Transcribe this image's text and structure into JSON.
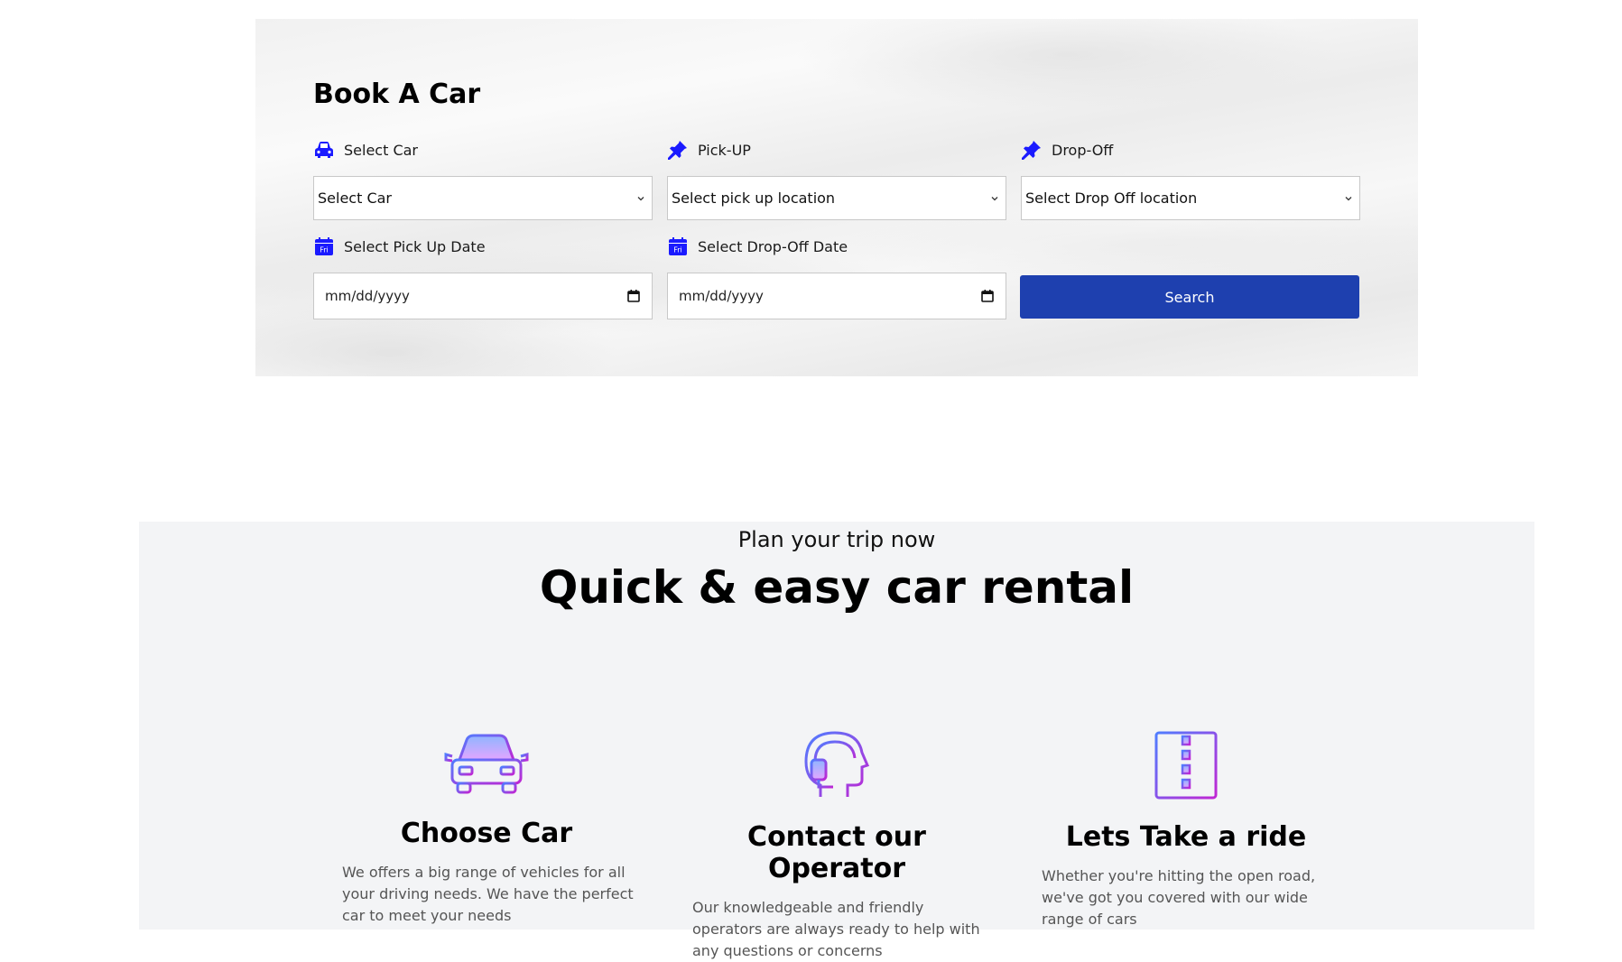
{
  "booking": {
    "title": "Book A Car",
    "select_car": {
      "label": "Select Car",
      "value": "Select Car"
    },
    "pick_up": {
      "label": "Pick-UP",
      "value": "Select pick up location"
    },
    "drop_off": {
      "label": "Drop-Off",
      "value": "Select Drop Off location"
    },
    "pick_up_date": {
      "label": "Select Pick Up Date",
      "placeholder": "mm/dd/yyyy",
      "icon_text": "Fri"
    },
    "drop_off_date": {
      "label": "Select Drop-Off Date",
      "placeholder": "mm/dd/yyyy",
      "icon_text": "Fri"
    },
    "search_label": "Search",
    "accent_color": "#1e40af",
    "icon_color": "#1a1aff"
  },
  "plan": {
    "subtitle": "Plan your trip now",
    "title": "Quick & easy car rental",
    "features": [
      {
        "icon": "car-icon",
        "title": "Choose Car",
        "text": "We offers a big range of vehicles for all your driving needs. We have the perfect car to meet your needs"
      },
      {
        "icon": "operator-icon",
        "title": "Contact our Operator",
        "text": "Our knowledgeable and friendly operators are always ready to help with any questions or concerns"
      },
      {
        "icon": "road-icon",
        "title": "Lets Take a ride",
        "text": "Whether you're hitting the open road, we've got you covered with our wide range of cars"
      }
    ]
  }
}
